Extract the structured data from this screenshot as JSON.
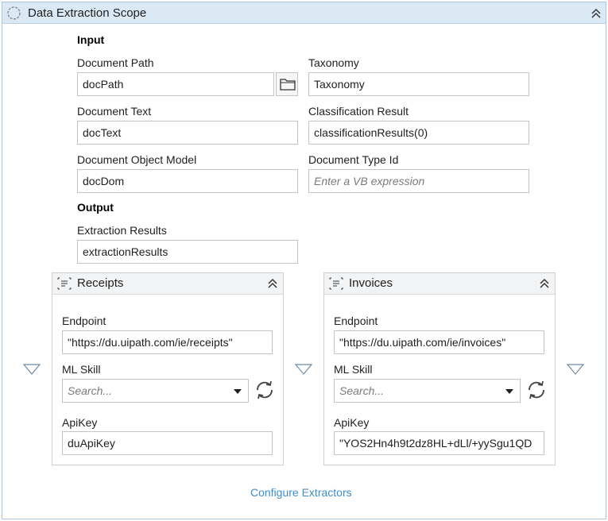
{
  "scope": {
    "title": "Data Extraction Scope",
    "input_section": "Input",
    "output_section": "Output",
    "document_path": {
      "label": "Document Path",
      "value": "docPath"
    },
    "taxonomy": {
      "label": "Taxonomy",
      "value": "Taxonomy"
    },
    "document_text": {
      "label": "Document Text",
      "value": "docText"
    },
    "classification_result": {
      "label": "Classification Result",
      "value": "classificationResults(0)"
    },
    "document_object_model": {
      "label": "Document Object Model",
      "value": "docDom"
    },
    "document_type_id": {
      "label": "Document Type Id",
      "placeholder": "Enter a VB expression"
    },
    "extraction_results": {
      "label": "Extraction Results",
      "value": "extractionResults"
    },
    "configure_extractors": "Configure Extractors"
  },
  "extractors": [
    {
      "title": "Receipts",
      "endpoint_label": "Endpoint",
      "endpoint_value": "\"https://du.uipath.com/ie/receipts\"",
      "ml_skill_label": "ML Skill",
      "ml_skill_placeholder": "Search...",
      "apikey_label": "ApiKey",
      "apikey_value": "duApiKey"
    },
    {
      "title": "Invoices",
      "endpoint_label": "Endpoint",
      "endpoint_value": "\"https://du.uipath.com/ie/invoices\"",
      "ml_skill_label": "ML Skill",
      "ml_skill_placeholder": "Search...",
      "apikey_label": "ApiKey",
      "apikey_value": "\"YOS2Hn4h9t2dz8HL+dLl/+yySgu1QD"
    }
  ],
  "icons": {
    "scope": "activity-scope-icon",
    "collapse": "double-chevron-up-icon",
    "browse": "folder-icon",
    "card": "extractor-icon",
    "refresh": "refresh-icon",
    "drop": "triangle-down-icon",
    "dropdown": "chevron-down-icon"
  },
  "colors": {
    "header_bg": "#dbe9f5",
    "border": "#a9c6de",
    "link": "#3c8dcc"
  }
}
